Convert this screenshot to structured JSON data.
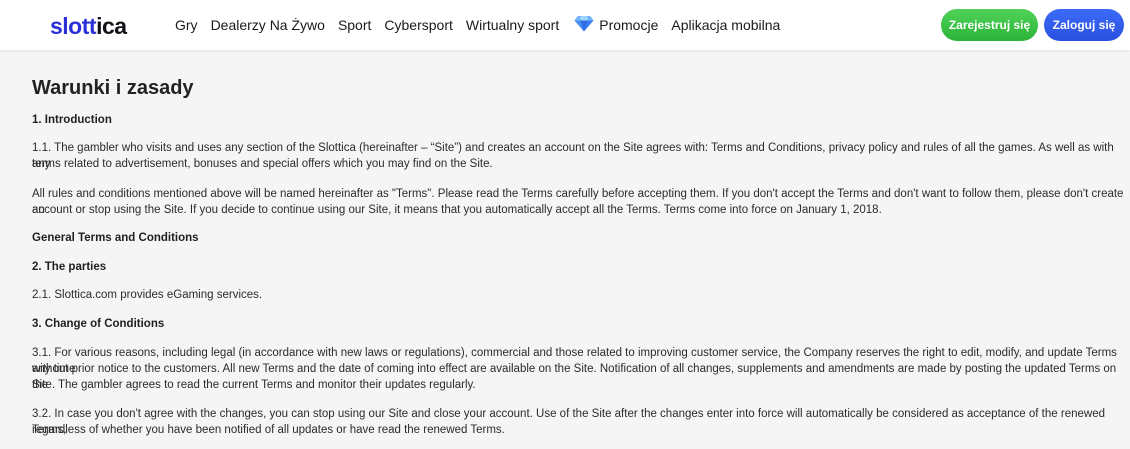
{
  "header": {
    "logo": {
      "part1": "slott",
      "part2": "ica"
    },
    "nav": [
      {
        "label": "Gry"
      },
      {
        "label": "Dealerzy Na Żywo"
      },
      {
        "label": "Sport"
      },
      {
        "label": "Cybersport"
      },
      {
        "label": "Wirtualny sport"
      },
      {
        "label": "Promocje",
        "icon": "diamond-icon"
      },
      {
        "label": "Aplikacja mobilna"
      }
    ],
    "register_label": "Zarejestruj się",
    "login_label": "Zaloguj się",
    "colors": {
      "register": "#3ac544",
      "login": "#3360ec",
      "logo_accent": "#2b2fd8"
    }
  },
  "main": {
    "title": "Warunki i zasady",
    "sections": {
      "intro_heading": "1. Introduction",
      "p_1_1_line1": "1.1. The gambler who visits and uses any section of the Slottica (hereinafter – “Site”) and creates an account on the Site agrees with: Terms and Conditions, privacy policy and rules of all the games. As well as with any",
      "p_1_1_line2": "terms related to advertisement, bonuses and special offers which you may find on the Site.",
      "p_rules_line1": "All rules and conditions mentioned above will be named hereinafter as \"Terms\". Please read the Terms carefully before accepting them. If you don't accept the Terms and don't want to follow them, please don't create an",
      "p_rules_line2": "account or stop using the Site. If you decide to continue using our Site, it means that you automatically accept all the Terms. Terms come into force on January 1, 2018.",
      "general_heading": "General Terms and Conditions",
      "parties_heading": "2. The parties",
      "p_2_1": "2.1. Slottica.com provides eGaming services.",
      "change_heading": "3. Change of Conditions",
      "p_3_1_line1": "3.1. For various reasons, including legal (in accordance with new laws or regulations), commercial and those related to improving customer service, the Company reserves the right to edit, modify, and update Terms any time",
      "p_3_1_line2": "without prior notice to the customers. All new Terms and the date of coming into effect are available on the Site. Notification of all changes, supplements and amendments are made by posting the updated Terms on the",
      "p_3_1_line3": "Site. The gambler agrees to read the current Terms and monitor their updates regularly.",
      "p_3_2_line1": "3.2. In case you don't agree with the changes, you can stop using our Site and close your account. Use of the Site after the changes enter into force will automatically be considered as acceptance of the renewed Terms,",
      "p_3_2_line2": "regardless of whether you have been notified of all updates or have read the renewed Terms."
    }
  }
}
